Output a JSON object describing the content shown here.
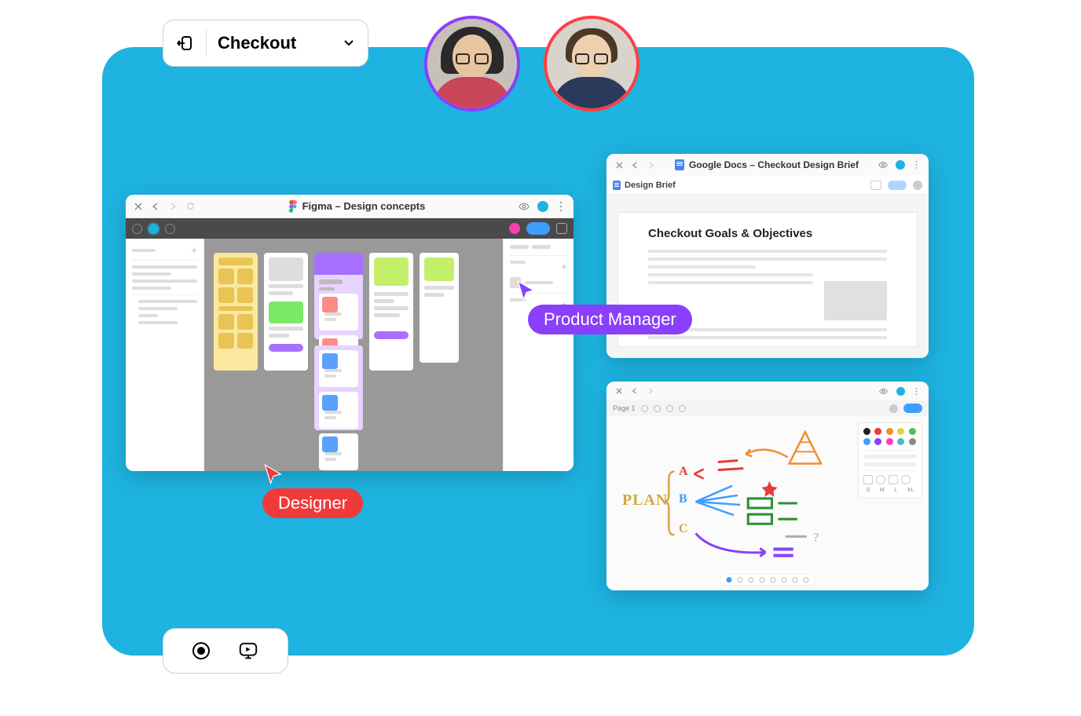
{
  "header": {
    "checkout_label": "Checkout"
  },
  "cursors": {
    "designer": "Designer",
    "pm": "Product Manager"
  },
  "figma": {
    "title": "Figma – Design concepts"
  },
  "gdocs": {
    "title": "Google Docs – Checkout Design Brief",
    "tab": "Design Brief",
    "heading": "Checkout Goals & Objectives"
  },
  "whiteboard": {
    "page_label": "Page 1",
    "plan": "PLAN",
    "options": [
      "A",
      "B",
      "C"
    ],
    "sizes": [
      "S",
      "M",
      "L",
      "XL"
    ],
    "palette_colors": [
      "#222",
      "#e83a3a",
      "#f09030",
      "#e8d040",
      "#4ac060",
      "#3d9fff",
      "#8a3ffc",
      "#ff3db0",
      "#40c0c0",
      "#888"
    ]
  }
}
